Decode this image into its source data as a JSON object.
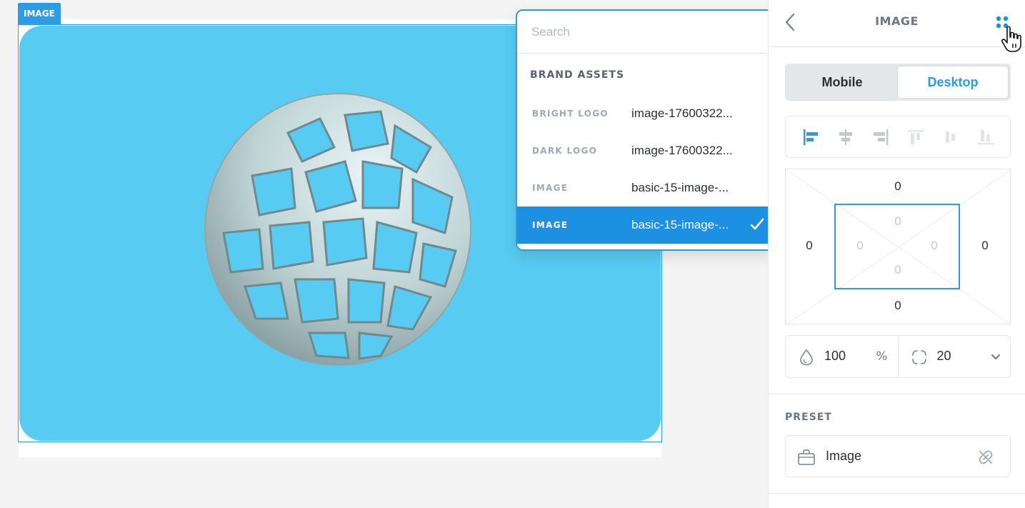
{
  "canvas": {
    "element_tag": "IMAGE",
    "image_background": "#58cbf2"
  },
  "asset_dropdown": {
    "search_placeholder": "Search",
    "group_title": "BRAND ASSETS",
    "items": [
      {
        "key": "BRIGHT LOGO",
        "value": "image-17600322...",
        "selected": false
      },
      {
        "key": "DARK LOGO",
        "value": "image-17600322...",
        "selected": false
      },
      {
        "key": "IMAGE",
        "value": "basic-15-image-...",
        "selected": false
      },
      {
        "key": "IMAGE",
        "value": "basic-15-image-...",
        "selected": true
      }
    ]
  },
  "panel": {
    "title": "IMAGE",
    "device_toggle": {
      "mobile": "Mobile",
      "desktop": "Desktop",
      "active": "desktop"
    },
    "alignment_icons": [
      "align-left-icon",
      "align-center-h-icon",
      "align-right-icon",
      "align-top-icon",
      "align-middle-v-icon",
      "align-bottom-icon"
    ],
    "spacing": {
      "margin_top": "0",
      "margin_right": "0",
      "margin_bottom": "0",
      "margin_left": "0",
      "padding_top": "0",
      "padding_right": "0",
      "padding_bottom": "0",
      "padding_left": "0"
    },
    "opacity": {
      "value": "100",
      "unit": "%"
    },
    "radius": {
      "value": "20"
    },
    "preset_label": "PRESET",
    "preset_name": "Image"
  },
  "colors": {
    "accent": "#2e9be6",
    "selected_row": "#1e90e2"
  }
}
